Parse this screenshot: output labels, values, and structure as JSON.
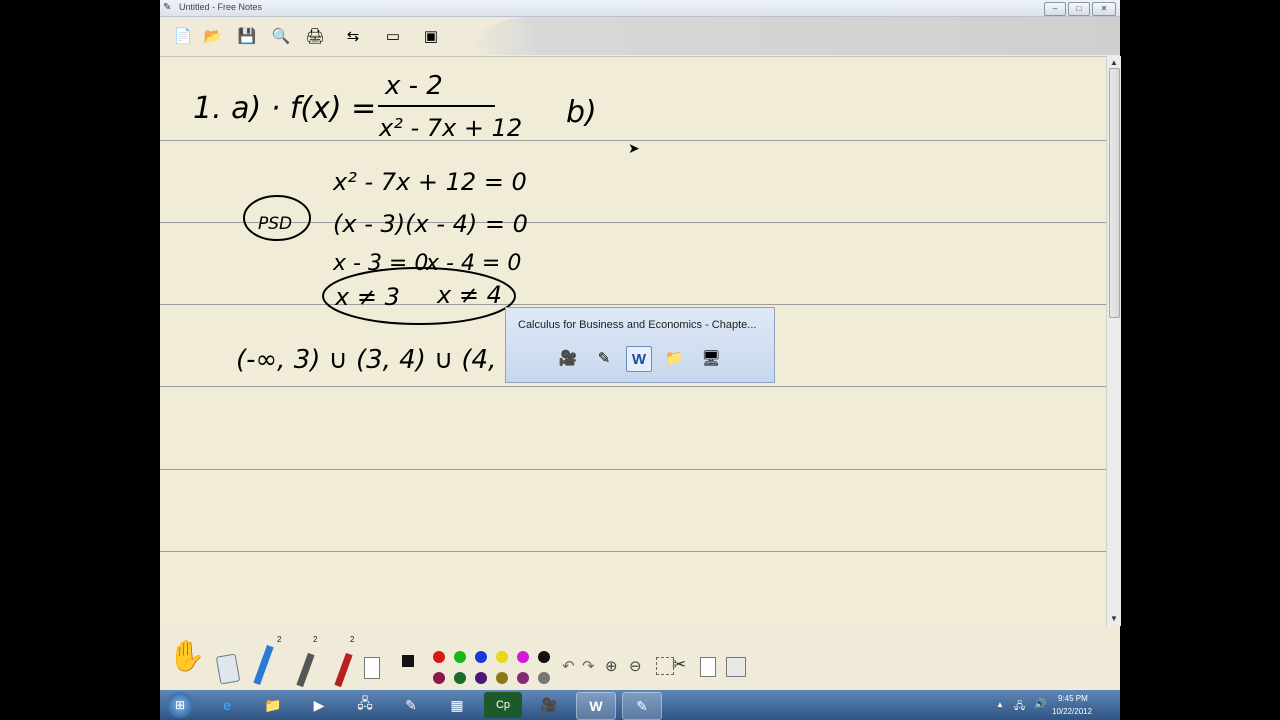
{
  "window": {
    "title": "Untitled - Free Notes",
    "app_icon": "pen-icon",
    "controls": {
      "minimize": "–",
      "maximize": "□",
      "close": "✕"
    }
  },
  "toolbar": {
    "buttons": [
      {
        "name": "new-icon",
        "glyph": "📄"
      },
      {
        "name": "open-icon",
        "glyph": "📂"
      },
      {
        "name": "save-icon",
        "glyph": "💾"
      },
      {
        "name": "print-preview-icon",
        "glyph": "🔍"
      },
      {
        "name": "print-icon",
        "glyph": "🖨"
      },
      {
        "name": "page-setup-icon",
        "glyph": "⇆"
      },
      {
        "name": "window-icon",
        "glyph": "▭"
      },
      {
        "name": "board-icon",
        "glyph": "▣"
      }
    ]
  },
  "handwriting": {
    "line1": "1. a) · f(x) =",
    "numerator": "x - 2",
    "denominator": "x² - 7x + 12",
    "part_b": "b)",
    "eq1": "x² - 7x + 12 = 0",
    "psd": "PSD",
    "eq2": "(x - 3)(x - 4) = 0",
    "eq3a": "x - 3 = 0",
    "eq3b": "x - 4 = 0",
    "res_a": "x ≠ 3",
    "res_b": "x ≠ 4",
    "domain": "(-∞, 3) ∪ (3, 4) ∪ (4, ∞"
  },
  "popup": {
    "title": "Calculus for Business and Economics - Chapte...",
    "icons": [
      {
        "name": "camtasia-icon",
        "glyph": "🎥"
      },
      {
        "name": "free-notes-icon",
        "glyph": "✎"
      },
      {
        "name": "word-icon",
        "glyph": "W",
        "selected": true
      },
      {
        "name": "folder-icon",
        "glyph": "📁"
      },
      {
        "name": "screen-icon",
        "glyph": "🖥"
      }
    ]
  },
  "bottom_tools": {
    "pen_labels": [
      "2",
      "2",
      "2"
    ],
    "colors_top": [
      "#d81818",
      "#18b818",
      "#1838d8",
      "#e8d818",
      "#d818d8",
      "#111111"
    ],
    "colors_bottom": [
      "#8a1848",
      "#1a6a2a",
      "#4a1878",
      "#8a7a18",
      "#8a2878",
      "#777777"
    ]
  },
  "taskbar": {
    "items": [
      {
        "name": "ie-icon",
        "glyph": "e"
      },
      {
        "name": "explorer-icon",
        "glyph": "📁"
      },
      {
        "name": "media-player-icon",
        "glyph": "▶"
      },
      {
        "name": "network-icon",
        "glyph": "🖧"
      },
      {
        "name": "free-notes-task-icon",
        "glyph": "✎"
      },
      {
        "name": "app-task-icon",
        "glyph": "▦"
      },
      {
        "name": "captivate-icon",
        "glyph": "Cp"
      },
      {
        "name": "camtasia-task-icon",
        "glyph": "🎥"
      },
      {
        "name": "word-task-icon",
        "glyph": "W"
      },
      {
        "name": "free-notes-task2-icon",
        "glyph": "✎"
      }
    ],
    "time": "9:45 PM",
    "date": "10/22/2012"
  }
}
